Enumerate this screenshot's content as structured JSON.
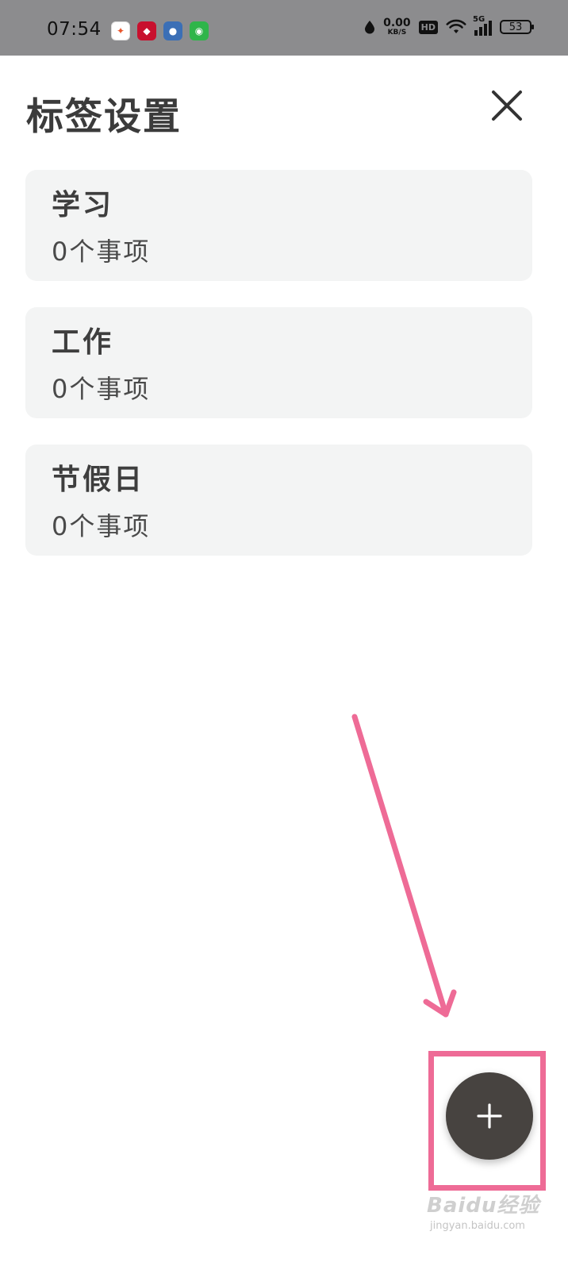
{
  "status_bar": {
    "time": "07:54",
    "net_speed_value": "0.00",
    "net_speed_unit": "KB/S",
    "hd_label": "HD",
    "signal_label": "5G",
    "battery": "53"
  },
  "header": {
    "title": "标签设置"
  },
  "tags": [
    {
      "name": "学习",
      "count": "0个事项"
    },
    {
      "name": "工作",
      "count": "0个事项"
    },
    {
      "name": "节假日",
      "count": "0个事项"
    }
  ],
  "watermark": {
    "main": "Baidu经验",
    "sub": "jingyan.baidu.com"
  },
  "colors": {
    "status_bar": "#8c8c8e",
    "card_bg": "#f3f4f4",
    "fab_bg": "#474340",
    "annotation": "#ee6b96"
  }
}
